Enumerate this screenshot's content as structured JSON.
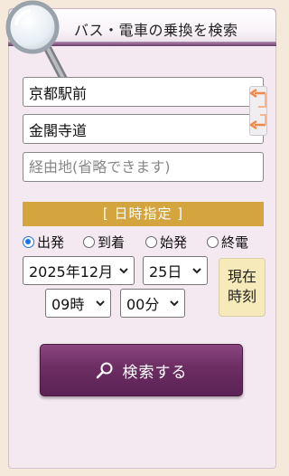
{
  "header": {
    "title": "バス・電車の乗換を検索"
  },
  "route": {
    "from_value": "京都駅前",
    "to_value": "金閣寺道",
    "via_placeholder": "経由地(省略できます)"
  },
  "datetime": {
    "section_label": "[ 日時指定 ]",
    "options": [
      "出発",
      "到着",
      "始発",
      "終電"
    ],
    "selected_option": "出発",
    "year_month": "2025年12月",
    "day": "25日",
    "hour": "09時",
    "minute": "00分",
    "now_label_line1": "現在",
    "now_label_line2": "時刻"
  },
  "search": {
    "label": "検索する"
  },
  "colors": {
    "accent": "#d4a43e",
    "button": "#6c2d63",
    "swap_arrow": "#f08a4b",
    "radio_selected": "#1a73e8"
  },
  "icons": [
    "magnifier-icon",
    "swap-arrow-icon",
    "search-icon",
    "chevron-down-icon"
  ]
}
